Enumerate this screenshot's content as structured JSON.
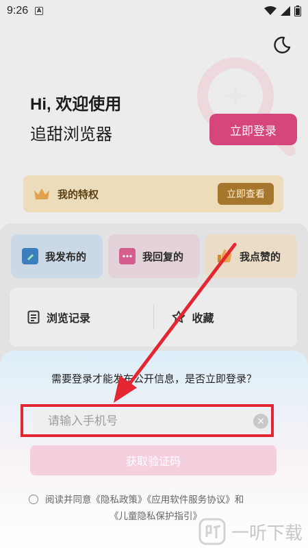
{
  "status_bar": {
    "time": "9:26",
    "a_badge": "A"
  },
  "header": {
    "greeting": "Hi, 欢迎使用",
    "app_name": "追甜浏览器",
    "login_button": "立即登录"
  },
  "privilege": {
    "title": "我的特权",
    "view_button": "立即查看"
  },
  "tiles": [
    {
      "label": "我发布的",
      "icon": "edit-icon"
    },
    {
      "label": "我回复的",
      "icon": "chat-icon"
    },
    {
      "label": "我点赞的",
      "icon": "thumbs-up-icon"
    }
  ],
  "records": {
    "history": "浏览记录",
    "favorites": "收藏"
  },
  "login_sheet": {
    "question": "需要登录才能发布公开信息，是否立即登录？",
    "phone_placeholder": "请输入手机号",
    "clear_symbol": "×",
    "code_button": "获取验证码",
    "agreement_line1": "阅读并同意《隐私政策》《应用软件服务协议》和",
    "agreement_line2": "《儿童隐私保护指引》"
  },
  "watermark": {
    "text": "一听下载"
  },
  "colors": {
    "accent": "#d6457c",
    "annotation": "#e32632"
  }
}
